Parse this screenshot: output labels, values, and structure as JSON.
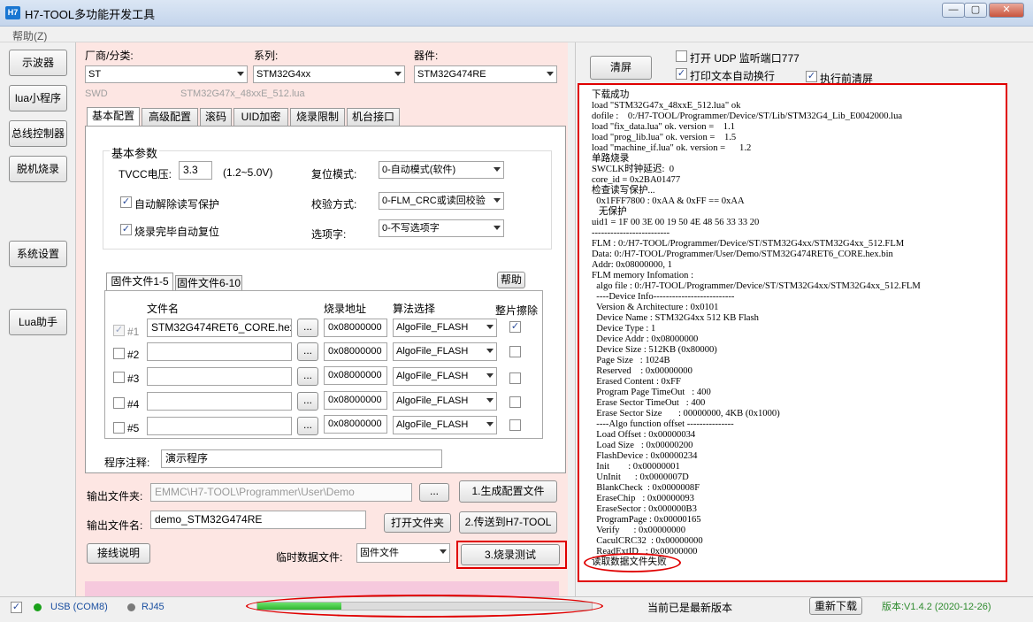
{
  "window": {
    "icon_text": "H7",
    "title": "H7-TOOL多功能开发工具",
    "min_glyph": "—",
    "max_glyph": "▢",
    "close_glyph": "✕"
  },
  "menu": {
    "help": "帮助(Z)"
  },
  "nav": [
    "示波器",
    "lua小程序",
    "总线控制器",
    "脱机烧录",
    "系统设置",
    "Lua助手"
  ],
  "selectors": {
    "vendor_label": "厂商/分类:",
    "vendor_value": "ST",
    "series_label": "系列:",
    "series_value": "STM32G4xx",
    "device_label": "器件:",
    "device_value": "STM32G474RE",
    "interface": "SWD",
    "lua_file": "STM32G47x_48xxE_512.lua"
  },
  "tabs": [
    "基本配置",
    "高级配置",
    "滚码",
    "UID加密",
    "烧录限制",
    "机台接口"
  ],
  "basic": {
    "group_title": "基本参数",
    "tvcc_label": "TVCC电压:",
    "tvcc_value": "3.3",
    "tvcc_range": "(1.2~5.0V)",
    "reset_label": "复位模式:",
    "reset_value": "0-自动模式(软件)",
    "unlock_label": "自动解除读写保护",
    "verify_label": "校验方式:",
    "verify_value": "0-FLM_CRC或读回校验",
    "autoreset_label": "烧录完毕自动复位",
    "option_label": "选项字:",
    "option_value": "0-不写选项字"
  },
  "firmware": {
    "tab1": "固件文件1-5",
    "tab2": "固件文件6-10",
    "help": "帮助",
    "col_file": "文件名",
    "col_addr": "烧录地址",
    "col_algo": "算法选择",
    "col_erase": "整片擦除",
    "dots": "...",
    "rows": [
      {
        "idx": "#1",
        "file": "STM32G474RET6_CORE.hex",
        "addr": "0x08000000",
        "algo": "AlgoFile_FLASH"
      },
      {
        "idx": "#2",
        "file": "",
        "addr": "0x08000000",
        "algo": "AlgoFile_FLASH"
      },
      {
        "idx": "#3",
        "file": "",
        "addr": "0x08000000",
        "algo": "AlgoFile_FLASH"
      },
      {
        "idx": "#4",
        "file": "",
        "addr": "0x08000000",
        "algo": "AlgoFile_FLASH"
      },
      {
        "idx": "#5",
        "file": "",
        "addr": "0x08000000",
        "algo": "AlgoFile_FLASH"
      }
    ],
    "comment_label": "程序注释:",
    "comment_value": "演示程序"
  },
  "output": {
    "folder_label": "输出文件夹:",
    "folder_value": "EMMC\\H7-TOOL\\Programmer\\User\\Demo",
    "dots": "...",
    "gen_button": "1.生成配置文件",
    "name_label": "输出文件名:",
    "name_value": "demo_STM32G474RE",
    "open_button": "打开文件夹",
    "send_button": "2.传送到H7-TOOL",
    "wiring_button": "接线说明",
    "temp_label": "临时数据文件:",
    "temp_value": "固件文件",
    "test_button": "3.烧录测试"
  },
  "right": {
    "clear_button": "清屏",
    "udp_label": "打开 UDP 监听端口777",
    "wrap_label": "打印文本自动换行",
    "preclear_label": "执行前清屏",
    "log_lines": [
      "下载成功",
      "load \"STM32G47x_48xxE_512.lua\" ok",
      "dofile :    0:/H7-TOOL/Programmer/Device/ST/Lib/STM32G4_Lib_E0042000.lua",
      "load \"fix_data.lua\" ok. version =    1.1",
      "load \"prog_lib.lua\" ok. version =    1.5",
      "load \"machine_if.lua\" ok. version =      1.2",
      "单路烧录",
      "SWCLK时钟延迟:  0",
      "core_id = 0x2BA01477",
      "检查读写保护...",
      "  0x1FFF7800 : 0xAA & 0xFF == 0xAA",
      "   无保护",
      "uid1 = 1F 00 3E 00 19 50 4E 48 56 33 33 20",
      "-------------------------",
      "FLM : 0:/H7-TOOL/Programmer/Device/ST/STM32G4xx/STM32G4xx_512.FLM",
      "Data: 0:/H7-TOOL/Programmer/User/Demo/STM32G474RET6_CORE.hex.bin",
      "Addr: 0x08000000, 1",
      "FLM memory Infomation :",
      "  algo file : 0:/H7-TOOL/Programmer/Device/ST/STM32G4xx/STM32G4xx_512.FLM",
      "  ----Device Info--------------------------",
      "  Version & Architecture : 0x0101",
      "  Device Name : STM32G4xx 512 KB Flash",
      "  Device Type : 1",
      "  Device Addr : 0x08000000",
      "  Device Size : 512KB (0x80000)",
      "  Page Size   : 1024B",
      "  Reserved    : 0x00000000",
      "  Erased Content : 0xFF",
      "  Program Page TimeOut   : 400",
      "  Erase Sector TimeOut   : 400",
      "  Erase Sector Size       : 00000000, 4KB (0x1000)",
      "  ----Algo function offset ---------------",
      "  Load Offset : 0x00000034",
      "  Load Size   : 0x00000200",
      "  FlashDevice : 0x00000234",
      "  Init        : 0x00000001",
      "  UnInit      : 0x0000007D",
      "  BlankCheck  : 0x0000008F",
      "  EraseChip   : 0x00000093",
      "  EraseSector : 0x000000B3",
      "  ProgramPage : 0x00000165",
      "  Verify      : 0x00000000",
      "  CaculCRC32  : 0x00000000",
      "  ReadExtID   : 0x00000000",
      "读取数据文件失败"
    ]
  },
  "status": {
    "usb_label": "USB (COM8)",
    "rj45_label": "RJ45",
    "progress_fraction": 0.25,
    "update_text": "当前已是最新版本",
    "redownload_button": "重新下载",
    "version_text": "版本:V1.4.2 (2020-12-26)",
    "usb_color": "#1aa11a",
    "rj45_color": "#7a7a7a",
    "version_color": "#2e8b2e",
    "highlight_color": "#e00000"
  }
}
